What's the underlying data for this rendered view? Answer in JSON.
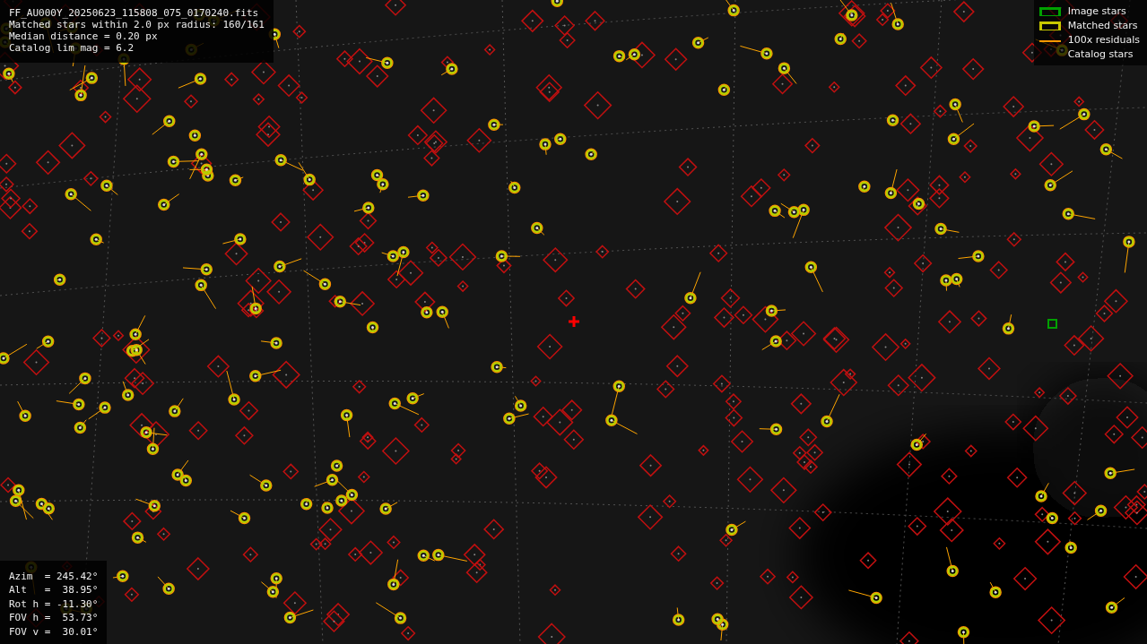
{
  "info_box": {
    "lines": [
      "FF_AU000Y_20250623_115808_075_0170240.fits",
      "Matched stars within 2.0 px radius: 160/161",
      "Median distance = 0.20 px",
      "Catalog lim mag = 6.2"
    ]
  },
  "legend": [
    {
      "kind": "box",
      "color": "#00a000",
      "label": "Image stars"
    },
    {
      "kind": "box",
      "color": "#c8c800",
      "label": "Matched stars"
    },
    {
      "kind": "line",
      "color": "#ff9900",
      "label": "100x residuals"
    },
    {
      "kind": "none",
      "label": "Catalog stars"
    }
  ],
  "pointing_box": {
    "lines": [
      "Azim  = 245.42°",
      "Alt   =  38.95°",
      "Rot h = -11.30°",
      "FOV h =  53.73°",
      "FOV v =  30.01°"
    ]
  }
}
